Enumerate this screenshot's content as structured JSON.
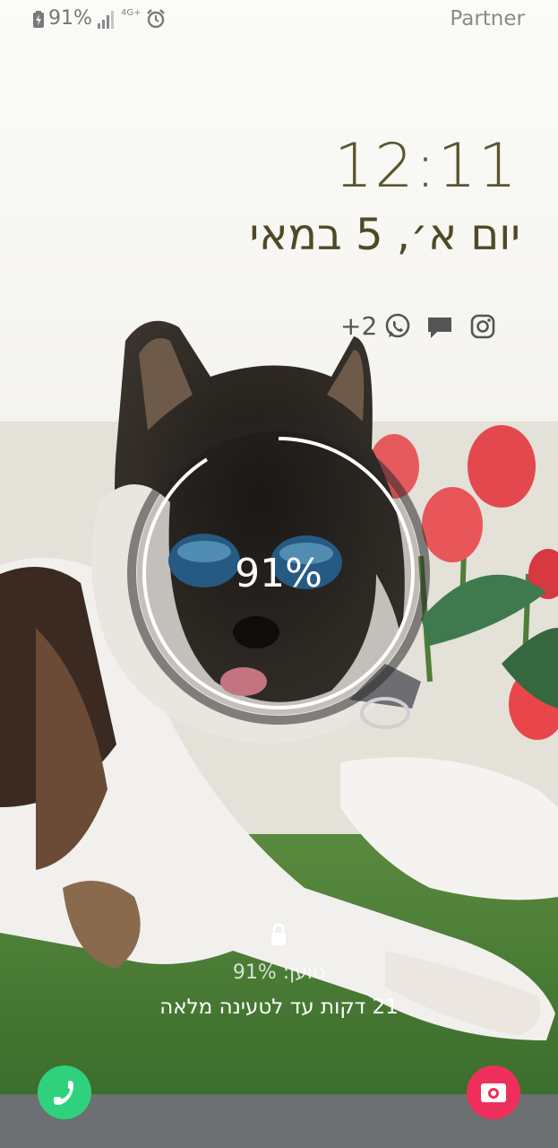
{
  "status_bar": {
    "battery_text": "91%",
    "network": "4G+",
    "carrier": "Partner",
    "icons": [
      "battery-charging-icon",
      "signal-icon",
      "network-4g-icon",
      "alarm-icon"
    ]
  },
  "clock": {
    "time": "12:11",
    "date": "יום א׳, 5 במאי"
  },
  "notifications": {
    "more_count": "+2",
    "icons": [
      "whatsapp-icon",
      "message-icon",
      "instagram-icon"
    ]
  },
  "charging": {
    "level_percent": 91,
    "ring_text": "91%",
    "status": "טוען: 91%",
    "eta": "21 דקות עד לטעינה מלאה"
  },
  "shortcuts": {
    "left": "phone-icon",
    "right": "camera-icon",
    "colors": {
      "phone": "#2fd17d",
      "camera": "#ef2f5b"
    }
  },
  "colors": {
    "clock": "#5a5530",
    "ring": "#ffffff"
  }
}
